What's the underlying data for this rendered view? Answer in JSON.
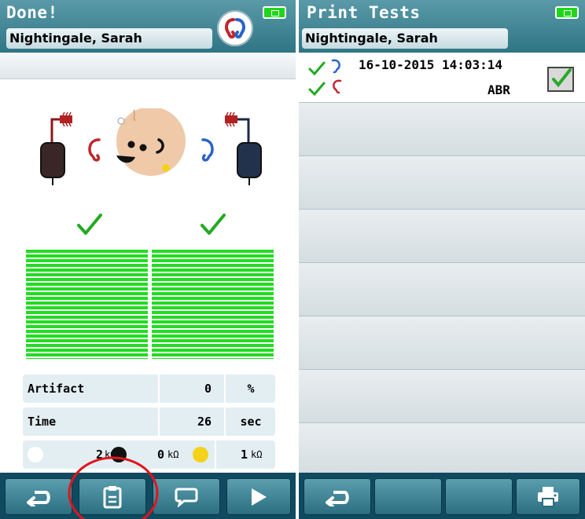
{
  "left": {
    "header": {
      "title": "Done!",
      "patient_name": "Nightingale, Sarah"
    },
    "results": {
      "left_ear_pass": true,
      "right_ear_pass": true
    },
    "table": {
      "artifact": {
        "label": "Artifact",
        "value": "0",
        "unit": "%"
      },
      "time": {
        "label": "Time",
        "value": "26",
        "unit": "sec"
      },
      "impedance": [
        {
          "electrode": "white-electrode",
          "value": "2",
          "unit": "kΩ"
        },
        {
          "electrode": "black-electrode",
          "value": "0",
          "unit": "kΩ"
        },
        {
          "electrode": "yellow-electrode",
          "value": "1",
          "unit": "kΩ"
        }
      ]
    },
    "toolbar": [
      "back-icon",
      "report-icon",
      "comment-icon",
      "play-icon"
    ]
  },
  "right": {
    "header": {
      "title": "Print Tests",
      "patient_name": "Nightingale, Sarah"
    },
    "test": {
      "datetime": "16-10-2015 14:03:14",
      "type": "ABR",
      "selected": true
    },
    "toolbar": [
      "back-icon",
      "",
      "",
      "print-icon"
    ]
  },
  "colors": {
    "header_top": "#5a9aa8",
    "header_bottom": "#2f7585",
    "toolbar": "#0f4a60",
    "pass_green": "#22dd22",
    "left_ear_red": "#c0262c",
    "right_ear_blue": "#2a63c8"
  }
}
